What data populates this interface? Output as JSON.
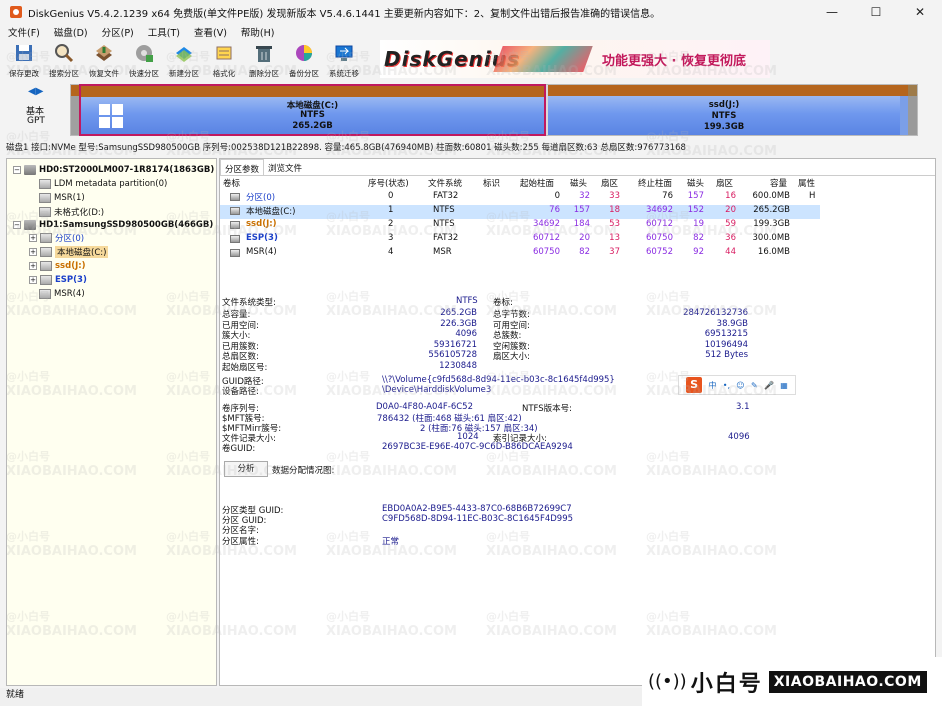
{
  "window": {
    "title": "DiskGenius V5.4.2.1239 x64 免费版(单文件PE版)   发现新版本 V5.4.6.1441   主要更新内容如下：2、复制文件出错后报告准确的错误信息。",
    "min": "—",
    "max": "☐",
    "close": "✕"
  },
  "menu": [
    "文件(F)",
    "磁盘(D)",
    "分区(P)",
    "工具(T)",
    "查看(V)",
    "帮助(H)"
  ],
  "toolbar": [
    {
      "label": "保存更改",
      "icon": "save-icon"
    },
    {
      "label": "搜索分区",
      "icon": "search-icon"
    },
    {
      "label": "恢复文件",
      "icon": "recover-icon"
    },
    {
      "label": "快速分区",
      "icon": "quick-partition-icon"
    },
    {
      "label": "新建分区",
      "icon": "new-partition-icon"
    },
    {
      "label": "格式化",
      "icon": "format-icon"
    },
    {
      "label": "删除分区",
      "icon": "delete-partition-icon"
    },
    {
      "label": "备份分区",
      "icon": "backup-icon"
    },
    {
      "label": "系统迁移",
      "icon": "migrate-icon"
    }
  ],
  "banner": {
    "logo": "DiskGenius",
    "slogan": "功能更强大 · 恢复更彻底"
  },
  "disk_nav": {
    "type_line1": "基本",
    "type_line2": "GPT"
  },
  "disk_map": {
    "c": {
      "name": "本地磁盘(C:)",
      "fs": "NTFS",
      "size": "265.2GB"
    },
    "j": {
      "name": "ssd(J:)",
      "fs": "NTFS",
      "size": "199.3GB"
    }
  },
  "disk_info": "磁盘1 接口:NVMe  型号:SamsungSSD980500GB  序列号:002538D121B22898.  容量:465.8GB(476940MB)  柱面数:60801  磁头数:255  每道扇区数:63  总扇区数:976773168",
  "tree": {
    "hd0": "HD0:ST2000LM007-1R8174(1863GB)",
    "hd0_items": [
      "LDM metadata partition(0)",
      "MSR(1)",
      "未格式化(D:)"
    ],
    "hd1": "HD1:SamsungSSD980500GB(466GB)",
    "hd1_items": [
      "分区(0)",
      "本地磁盘(C:)",
      "ssd(J:)",
      "ESP(3)",
      "MSR(4)"
    ]
  },
  "tabs": [
    "分区参数",
    "浏览文件"
  ],
  "partition_table": {
    "headers": [
      "卷标",
      "序号(状态)",
      "文件系统",
      "标识",
      "起始柱面",
      "磁头",
      "扇区",
      "终止柱面",
      "磁头",
      "扇区",
      "容量",
      "属性"
    ],
    "rows": [
      {
        "label": "分区(0)",
        "idx": "0",
        "fs": "FAT32",
        "flag": "",
        "sc": "0",
        "sh": "32",
        "ss": "33",
        "ec": "76",
        "eh": "157",
        "es": "16",
        "cap": "600.0MB",
        "attr": "H"
      },
      {
        "label": "本地磁盘(C:)",
        "idx": "1",
        "fs": "NTFS",
        "flag": "",
        "sc": "76",
        "sh": "157",
        "ss": "18",
        "ec": "34692",
        "eh": "152",
        "es": "20",
        "cap": "265.2GB",
        "attr": ""
      },
      {
        "label": "ssd(J:)",
        "idx": "2",
        "fs": "NTFS",
        "flag": "",
        "sc": "34692",
        "sh": "184",
        "ss": "53",
        "ec": "60712",
        "eh": "19",
        "es": "59",
        "cap": "199.3GB",
        "attr": ""
      },
      {
        "label": "ESP(3)",
        "idx": "3",
        "fs": "FAT32",
        "flag": "",
        "sc": "60712",
        "sh": "20",
        "ss": "13",
        "ec": "60750",
        "eh": "82",
        "es": "36",
        "cap": "300.0MB",
        "attr": ""
      },
      {
        "label": "MSR(4)",
        "idx": "4",
        "fs": "MSR",
        "flag": "",
        "sc": "60750",
        "sh": "82",
        "ss": "37",
        "ec": "60752",
        "eh": "92",
        "es": "44",
        "cap": "16.0MB",
        "attr": ""
      }
    ]
  },
  "info": {
    "fs_type_label": "文件系统类型:",
    "fs_type": "NTFS",
    "vol_label_label": "卷标:",
    "vol_label": "",
    "left": [
      [
        "总容量:",
        "265.2GB"
      ],
      [
        "已用空间:",
        "226.3GB"
      ],
      [
        "簇大小:",
        "4096"
      ],
      [
        "已用簇数:",
        "59316721"
      ],
      [
        "总扇区数:",
        "556105728"
      ],
      [
        "起始扇区号:",
        "1230848"
      ]
    ],
    "right": [
      [
        "总字节数:",
        "284726132736"
      ],
      [
        "可用空间:",
        "38.9GB"
      ],
      [
        "总簇数:",
        "69513215"
      ],
      [
        "空闲簇数:",
        "10196494"
      ],
      [
        "扇区大小:",
        "512 Bytes"
      ]
    ],
    "guid_path_label": "GUID路径:",
    "guid_path": "\\\\?\\Volume{c9fd568d-8d94-11ec-b03c-8c1645f4d995}",
    "device_path_label": "设备路径:",
    "device_path": "\\Device\\HarddiskVolume3",
    "serial_label": "卷序列号:",
    "serial": "D0A0-4F80-A04F-6C52",
    "ntfs_ver_label": "NTFS版本号:",
    "ntfs_ver": "3.1",
    "mft_label": "$MFT簇号:",
    "mft": "786432 (柱面:468 磁头:61 扇区:42)",
    "mftmirr_label": "$MFTMirr簇号:",
    "mftmirr": "2 (柱面:76 磁头:157 扇区:34)",
    "frs_label": "文件记录大小:",
    "frs": "1024",
    "idx_label": "索引记录大小:",
    "idx": "4096",
    "vguid_label": "卷GUID:",
    "vguid": "2697BC3E-E96E-407C-9C6D-B86DCAEA9294",
    "analyze": "分析",
    "alloc_label": "数据分配情况图:",
    "ptype_label": "分区类型 GUID:",
    "ptype": "EBD0A0A2-B9E5-4433-87C0-68B6B72699C7",
    "pguid_label": "分区 GUID:",
    "pguid": "C9FD568D-8D94-11EC-B03C-8C1645F4D995",
    "pname_label": "分区名字:",
    "pname": "",
    "pattr_label": "分区属性:",
    "pattr": "正常"
  },
  "ime": {
    "logo": "S",
    "items": [
      "中",
      "•,",
      "☺",
      "✎",
      "🎤",
      "▦"
    ]
  },
  "status": "就绪",
  "watermark": {
    "cn": "小白号",
    "en": "XIAOBAIHAO.COM",
    "at": "@小白号"
  }
}
